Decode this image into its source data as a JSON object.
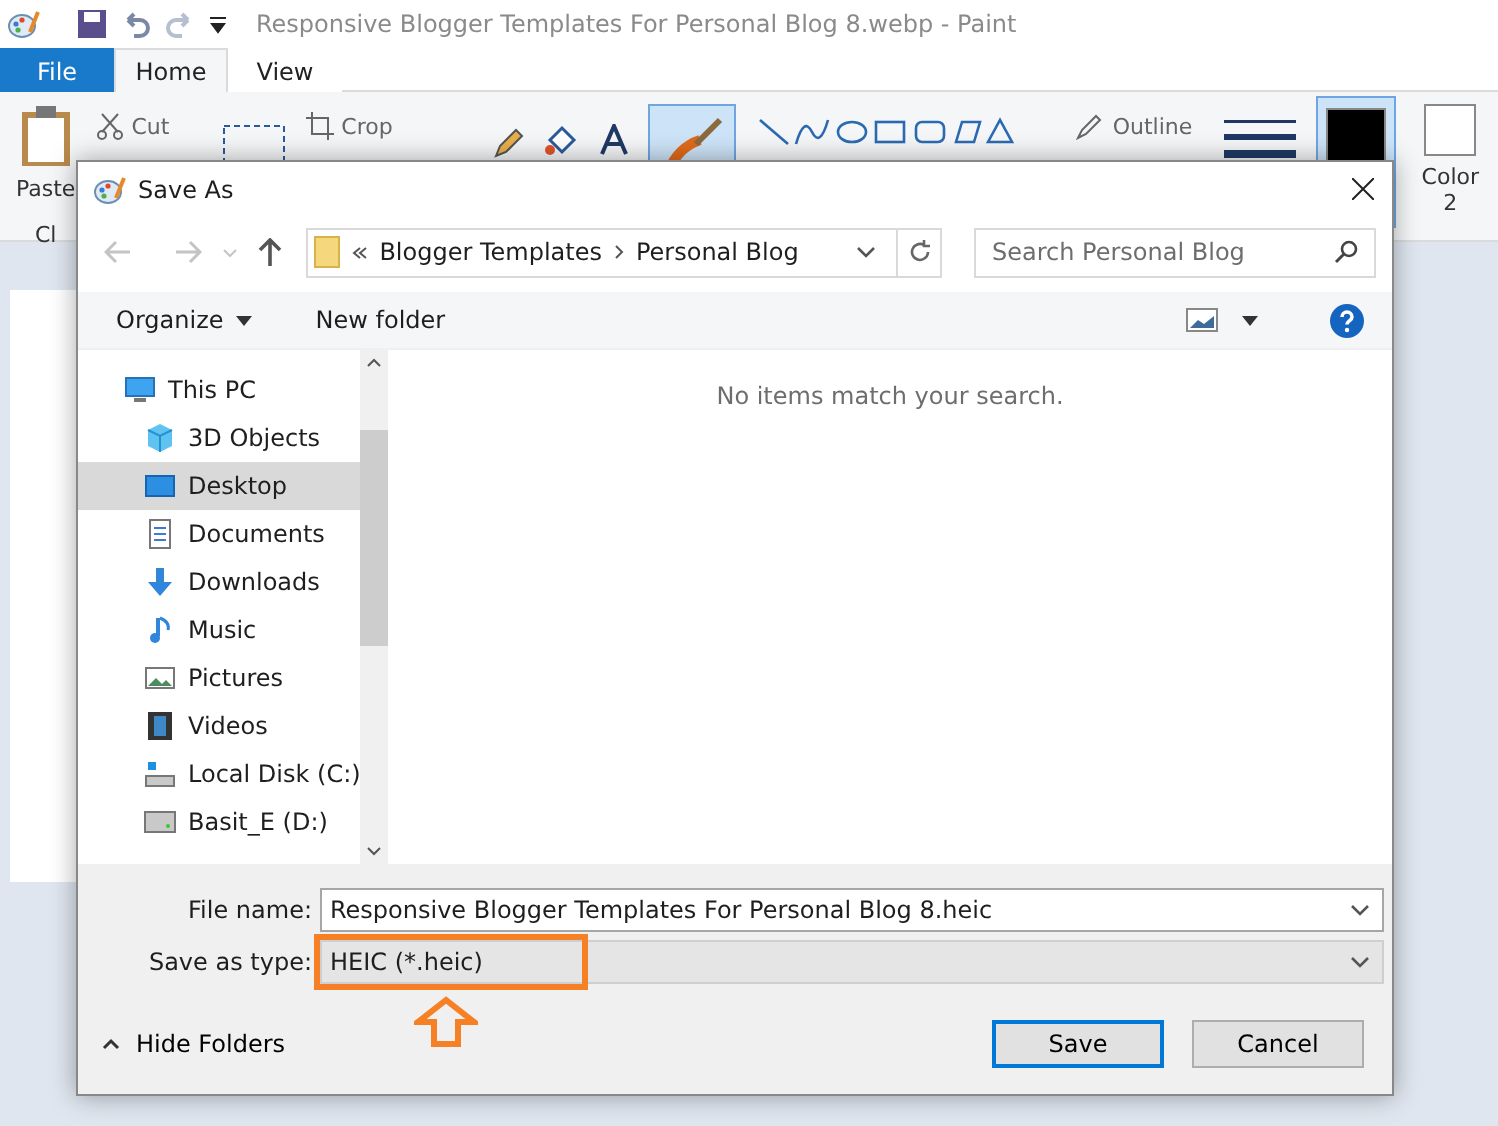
{
  "paint": {
    "title": "Responsive Blogger Templates For Personal Blog 8.webp - Paint",
    "tabs": [
      {
        "label": "File",
        "selected": false,
        "kind": "file"
      },
      {
        "label": "Home",
        "selected": true,
        "kind": "tab"
      },
      {
        "label": "View",
        "selected": false,
        "kind": "tab"
      }
    ],
    "ribbon": {
      "paste": "Paste",
      "clipboard_group": "Cl",
      "cut": "Cut",
      "crop": "Crop",
      "outline": "Outline",
      "color_2": "Color 2"
    }
  },
  "dialog": {
    "title": "Save As",
    "breadcrumb": [
      "Blogger Templates",
      "Personal Blog"
    ],
    "search": {
      "placeholder": "Search Personal Blog"
    },
    "toolbar": {
      "organize": "Organize",
      "new_folder": "New folder"
    },
    "nav": [
      {
        "label": "This PC",
        "kind": "pc",
        "selected": false,
        "children": [
          {
            "label": "3D Objects",
            "kind": "cube",
            "selected": false
          },
          {
            "label": "Desktop",
            "kind": "desktop",
            "selected": true
          },
          {
            "label": "Documents",
            "kind": "documents",
            "selected": false
          },
          {
            "label": "Downloads",
            "kind": "downloads",
            "selected": false
          },
          {
            "label": "Music",
            "kind": "music",
            "selected": false
          },
          {
            "label": "Pictures",
            "kind": "pictures",
            "selected": false
          },
          {
            "label": "Videos",
            "kind": "videos",
            "selected": false
          },
          {
            "label": "Local Disk (C:)",
            "kind": "disk",
            "selected": false
          },
          {
            "label": "Basit_E (D:)",
            "kind": "drive",
            "selected": false
          }
        ]
      }
    ],
    "empty_message": "No items match your search.",
    "file_name": {
      "label": "File name:",
      "value": "Responsive Blogger Templates For Personal Blog 8.heic"
    },
    "save_as_type": {
      "label": "Save as type:",
      "value": "HEIC (*.heic)",
      "highlighted": true
    },
    "hide_folders": "Hide Folders",
    "buttons": [
      {
        "label": "Save",
        "default": true
      },
      {
        "label": "Cancel",
        "default": false
      }
    ]
  }
}
